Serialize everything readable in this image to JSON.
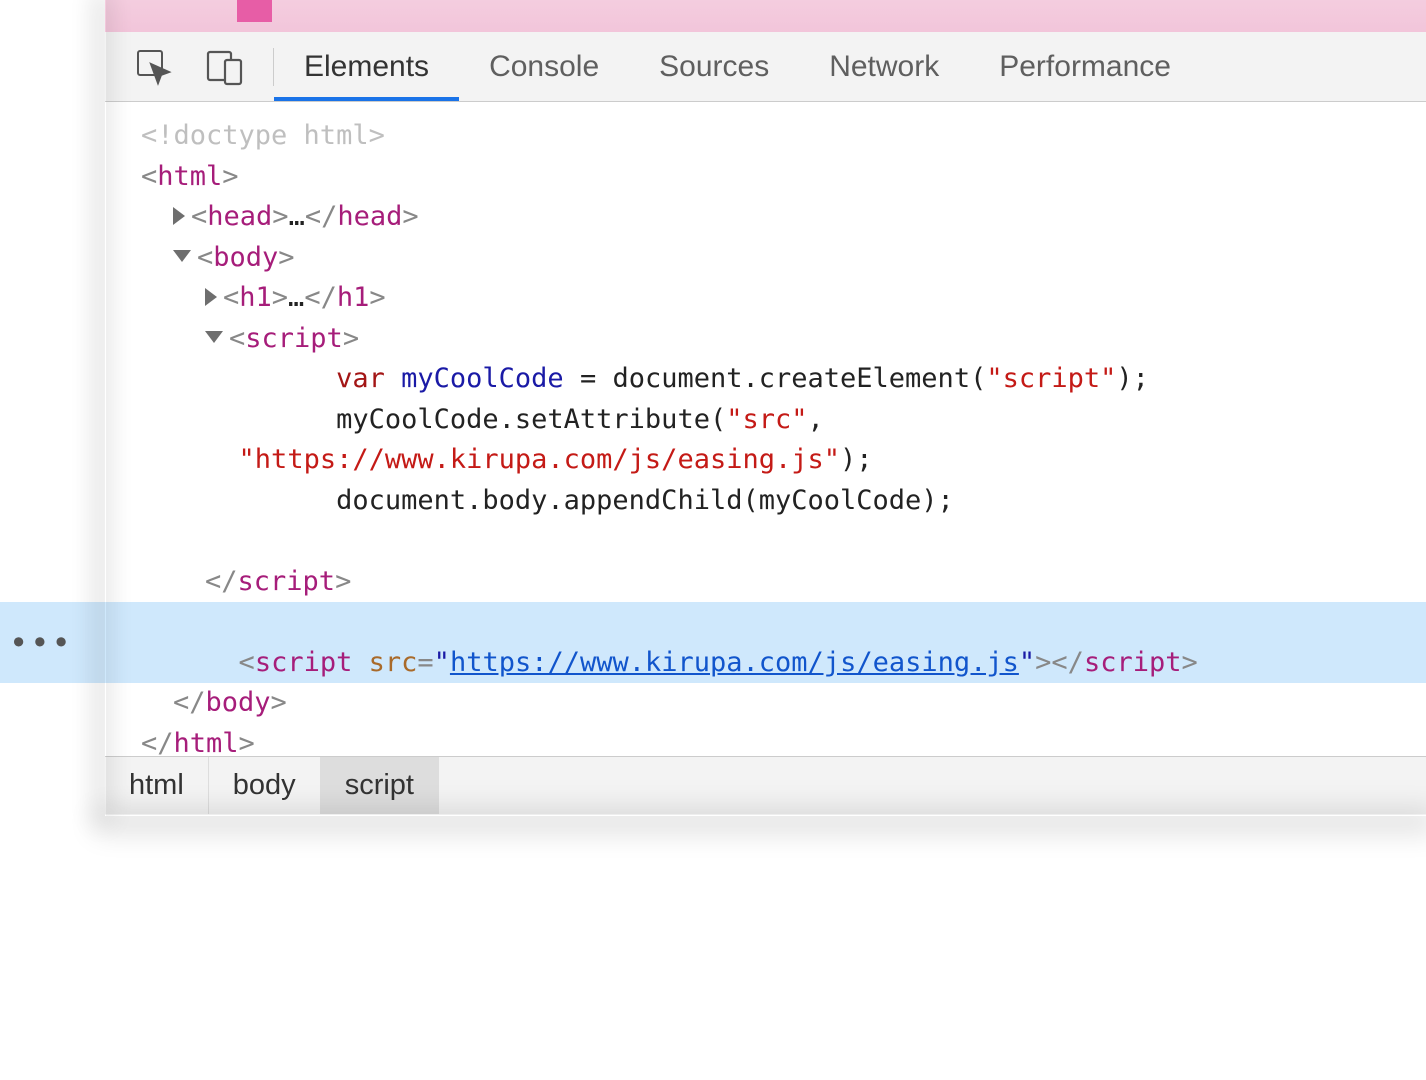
{
  "tabs": {
    "elements": "Elements",
    "console": "Console",
    "sources": "Sources",
    "network": "Network",
    "performance": "Performance"
  },
  "dom": {
    "doctype": "<!doctype html>",
    "html_open_lt": "<",
    "html_tag": "html",
    "gt": ">",
    "head_open_lt": "<",
    "head_tag": "head",
    "ellipsis": "…",
    "head_close_lt": "</",
    "body_open_lt": "<",
    "body_tag": "body",
    "h1_open_lt": "<",
    "h1_tag": "h1",
    "h1_close_lt": "</",
    "script_open_lt": "<",
    "script_tag": "script",
    "code_kw_var": "var",
    "code_varname": "myCoolCode",
    "code_l1_rest": " = document.createElement(",
    "code_l1_str": "\"script\"",
    "code_l1_end": ");",
    "code_l2_a": "myCoolCode.setAttribute(",
    "code_l2_str": "\"src\"",
    "code_l2_end": ", ",
    "code_l3_str": "\"https://www.kirupa.com/js/easing.js\"",
    "code_l3_end": ");",
    "code_l4": "document.body.appendChild(myCoolCode);",
    "script_close_lt": "</",
    "sel_script_open_lt": "<",
    "sel_script_tag": "script",
    "sel_attr_name": "src",
    "sel_eq": "=",
    "sel_q": "\"",
    "sel_url": "https://www.kirupa.com/js/easing.js",
    "sel_close_lt": "</",
    "body_close_lt": "</",
    "html_close_lt": "</"
  },
  "breadcrumb": {
    "c1": "html",
    "c2": "body",
    "c3": "script"
  }
}
